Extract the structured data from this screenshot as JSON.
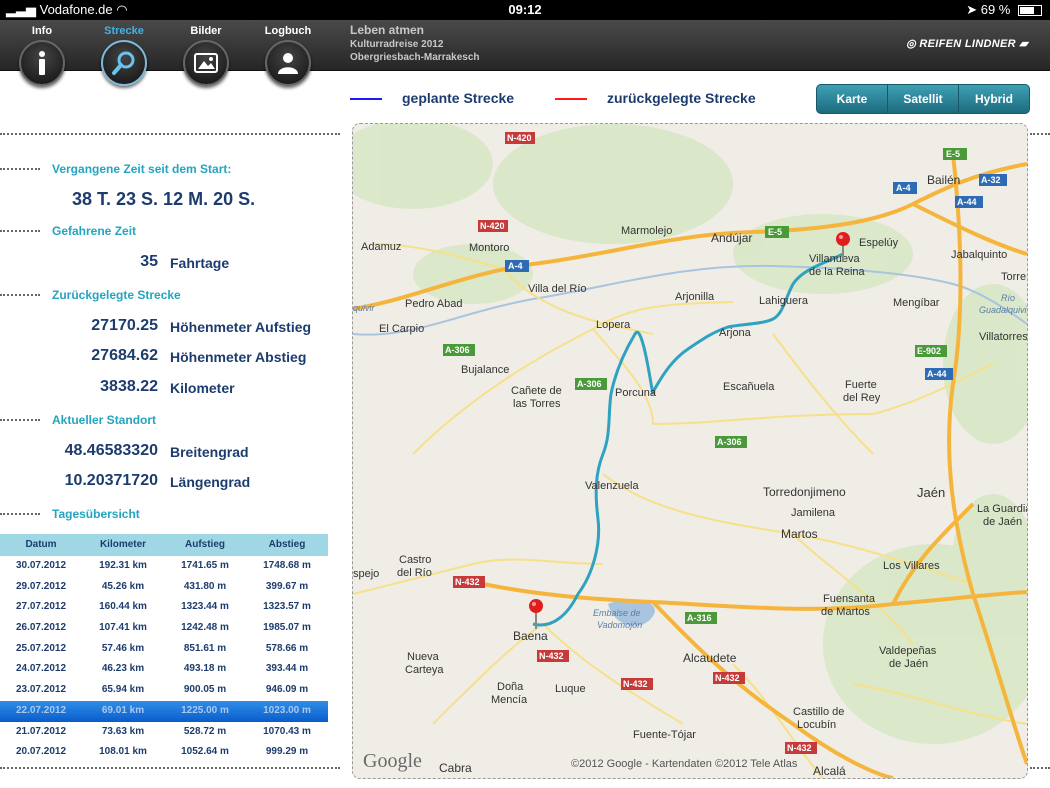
{
  "statusbar": {
    "carrier": "Vodafone.de",
    "time": "09:12",
    "battery": "69 %",
    "battery_fill": 0.69
  },
  "tabs": [
    {
      "label": "Info"
    },
    {
      "label": "Strecke"
    },
    {
      "label": "Bilder"
    },
    {
      "label": "Logbuch"
    }
  ],
  "appinfo": {
    "title": "Leben atmen",
    "line2": "Kulturradreise 2012",
    "line3": "Obergriesbach-Marrakesch"
  },
  "brand": "REIFEN LINDNER",
  "legend": {
    "planned": "geplante Strecke",
    "traveled": "zurückgelegte Strecke",
    "planned_color": "#1a1aff",
    "traveled_color": "#ff1a1a"
  },
  "maptype": {
    "karte": "Karte",
    "satellit": "Satellit",
    "hybrid": "Hybrid"
  },
  "stats": {
    "elapsed_title": "Vergangene Zeit seit dem Start:",
    "elapsed_value": "38 T. 23 S. 12 M. 20 S.",
    "driving_title": "Gefahrene Zeit",
    "driving_num": "35",
    "driving_label": "Fahrtage",
    "distance_title": "Zurückgelegte Strecke",
    "ascent_num": "27170.25",
    "ascent_label": "Höhenmeter Aufstieg",
    "descent_num": "27684.62",
    "descent_label": "Höhenmeter Abstieg",
    "km_num": "3838.22",
    "km_label": "Kilometer",
    "location_title": "Aktueller Standort",
    "lat_num": "48.46583320",
    "lat_label": "Breitengrad",
    "lon_num": "10.20371720",
    "lon_label": "Längengrad",
    "daily_title": "Tagesübersicht"
  },
  "table": {
    "headers": [
      "Datum",
      "Kilometer",
      "Aufstieg",
      "Abstieg"
    ],
    "rows": [
      [
        "30.07.2012",
        "192.31 km",
        "1741.65 m",
        "1748.68 m"
      ],
      [
        "29.07.2012",
        "45.26 km",
        "431.80 m",
        "399.67 m"
      ],
      [
        "27.07.2012",
        "160.44 km",
        "1323.44 m",
        "1323.57 m"
      ],
      [
        "26.07.2012",
        "107.41 km",
        "1242.48 m",
        "1985.07 m"
      ],
      [
        "25.07.2012",
        "57.46 km",
        "851.61 m",
        "578.66 m"
      ],
      [
        "24.07.2012",
        "46.23 km",
        "493.18 m",
        "393.44 m"
      ],
      [
        "23.07.2012",
        "65.94 km",
        "900.05 m",
        "946.09 m"
      ],
      [
        "22.07.2012",
        "69.01 km",
        "1225.00 m",
        "1023.00 m"
      ],
      [
        "21.07.2012",
        "73.63 km",
        "528.72 m",
        "1070.43 m"
      ],
      [
        "20.07.2012",
        "108.01 km",
        "1052.64 m",
        "999.29 m"
      ]
    ],
    "selected_index": 7
  },
  "map": {
    "google": "Google",
    "copyright": "©2012 Google -  Kartendaten ©2012 Tele Atlas",
    "places": {
      "adamuz": "Adamuz",
      "montoro": "Montoro",
      "marmolejo": "Marmolejo",
      "andujar": "Andújar",
      "espeluy": "Espelúy",
      "bailen": "Bailén",
      "villanueva1": "Villanueva",
      "villanueva2": "de la Reina",
      "jabalquinto": "Jabalquinto",
      "torre": "Torre",
      "pedroabad": "Pedro Abad",
      "villadelrio": "Villa del Río",
      "arjonilla": "Arjonilla",
      "lahiguera": "Lahiguera",
      "mengibar": "Mengíbar",
      "rio": "Río",
      "guadalquivir": "Guadalquivir",
      "quivir": "quivir",
      "elcarpio": "El Carpio",
      "lopera": "Lopera",
      "arjona": "Arjona",
      "villatorres": "Villatorres",
      "bujalance": "Bujalance",
      "canete1": "Cañete de",
      "canete2": "las Torres",
      "porcuna": "Porcuna",
      "escanuela": "Escañuela",
      "fuerte1": "Fuerte",
      "fuerte2": "del Rey",
      "valenzuela": "Valenzuela",
      "torredonjimeno": "Torredonjimeno",
      "jaen": "Jaén",
      "jamilena": "Jamilena",
      "laguardia1": "La Guardia",
      "laguardia2": "de Jaén",
      "martos": "Martos",
      "castro1": "Castro",
      "castro2": "del Río",
      "espejo": "spejo",
      "losvillares": "Los Villares",
      "fuensanta1": "Fuensanta",
      "fuensanta2": "de Martos",
      "embalse1": "Embalse de",
      "embalse2": "Vadomojón",
      "baena": "Baena",
      "nueva1": "Nueva",
      "nueva2": "Carteya",
      "alcaudete": "Alcaudete",
      "valdepenas1": "Valdepeñas",
      "valdepenas2": "de Jaén",
      "dona1": "Doña",
      "dona2": "Mencía",
      "luque": "Luque",
      "castillo1": "Castillo de",
      "castillo2": "Locubín",
      "fuentetojar": "Fuente-Tójar",
      "cabra": "Cabra",
      "alcala": "Alcalá"
    },
    "roads": {
      "n420": "N-420",
      "e5": "E-5",
      "a4": "A-4",
      "a32": "A-32",
      "a44": "A-44",
      "a306": "A-306",
      "e902": "E-902",
      "a316": "A-316",
      "n432": "N-432"
    }
  }
}
